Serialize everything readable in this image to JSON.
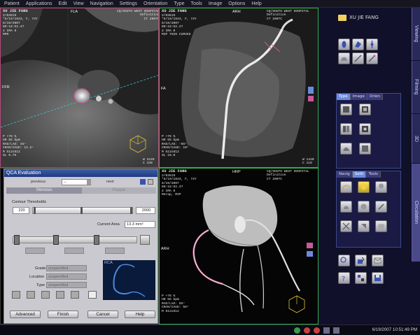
{
  "menu": [
    "Patient",
    "Applications",
    "Edit",
    "View",
    "Navigation",
    "Settings",
    "Orientation",
    "Type",
    "Tools",
    "Image",
    "Options",
    "Help"
  ],
  "viewports": {
    "tl": {
      "name": "XU JIE FANG",
      "info": "2/03819\n*8/19/1933, F, 74Y\n6/19/2007\n09:18:52.47\n4 IMA 0\nMPR",
      "hospital": "CQ/SOUTH WEST HOSPITAL\nDefinition\nCT 2007C",
      "orient_top": "FLA",
      "orient_left": "FFR",
      "params": "P +76 %\nHR 55 bpm\nRAO/LAO: 45°\nCRAN/CAUD: 12.2°\nM 512x512\nSL 0.75",
      "wl": "W 3240\nC 440"
    },
    "tr": {
      "name": "XU JIE FANG",
      "info": "2/03819\n*8/19/1933, F, 74Y\n6/19/2007\n09:18:52.47\n4 IMA 0\nMIP THIN CURVED",
      "hospital": "CQ/SOUTH WEST HOSPITAL\nDefinition\nCT 2007C",
      "orient_top": "ARH",
      "orient_left": "FA",
      "params": "P +76 %\nHR 55 bpm\nRAO/LAO: -65°\nCRAN/CAUD: 10°\nM 512x512\nSL 10.0",
      "wl": "W 1440\nC 110"
    },
    "br": {
      "name": "XU JIE FANG",
      "info": "2/03819\n*8/19/1933, F, 74Y\n6/19/2007\n09:18:52.47\n4 IMA 0\nMerap, MIP",
      "hospital": "CQ/SOUTH WEST HOSPITAL\nDefinition\nCT 2007C",
      "orient_top": "HRP",
      "orient_left": "ARH",
      "params": "P +76 %\nHR 55 bpm\nRAO/LAO: 85°\nCRAN/CAUD: 58°\nM 512x512"
    }
  },
  "right_panel": {
    "patient": "XU JIE FANG",
    "tabs": [
      "Viewing",
      "Filming",
      "3D",
      "Circulation"
    ],
    "type_tabs": [
      "Type",
      "Image",
      "Orien"
    ],
    "tool_tabs": [
      "Navig",
      "Setti",
      "Tools"
    ]
  },
  "qca": {
    "title": "QCA Evaluation",
    "previous": "previous",
    "next": "next",
    "segment_value": "--",
    "tab_stenosis": "Stenosis",
    "tab_plaque": "Plaque",
    "contour_label": "Contour Thresholds",
    "thr_low": "220",
    "thr_high": "2000",
    "current_area_label": "Current Area",
    "current_area_value": "13.3 mm²",
    "grade_label": "Grade",
    "grade_value": "unspecified",
    "location_label": "Location",
    "location_value": "unspecified",
    "type_label": "Type",
    "type_value": "unspecified",
    "rca_label": "RCA",
    "advanced": "Advanced",
    "finish": "Finish",
    "cancel": "Cancel",
    "help": "Help"
  },
  "taskbar": {
    "datetime": "6/19/2007 10:51:49 PM"
  },
  "colors": {
    "active_green": "#2fb04e",
    "active_pink": "#b5487a",
    "panel_bg": "#10102a",
    "dialog_title": "#2b4a95"
  }
}
